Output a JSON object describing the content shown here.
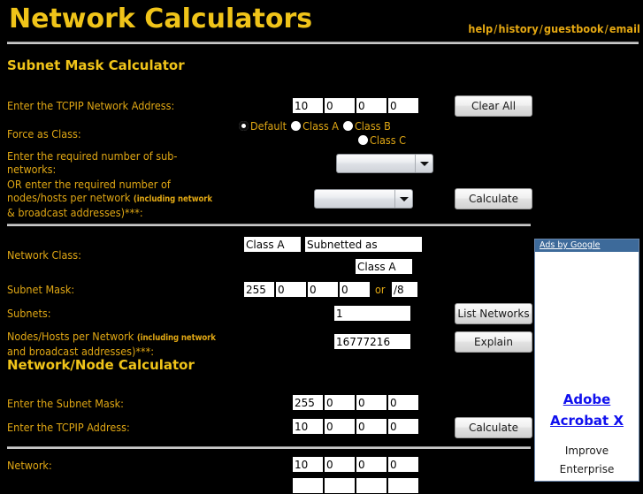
{
  "header": {
    "title": "Network Calculators",
    "nav": [
      {
        "label": "help"
      },
      {
        "label": "history"
      },
      {
        "label": "guestbook"
      },
      {
        "label": "email"
      }
    ],
    "separator": "/"
  },
  "subnet_calculator": {
    "title": "Subnet Mask Calculator",
    "network_address": {
      "label": "Enter the TCPIP Network Address:",
      "octets": [
        "10",
        "0",
        "0",
        "0"
      ],
      "clear_button": "Clear All"
    },
    "force_class": {
      "label": "Force as Class:",
      "options": [
        {
          "label": "Default",
          "selected": true
        },
        {
          "label": "Class A",
          "selected": false
        },
        {
          "label": "Class B",
          "selected": false
        },
        {
          "label": "Class C",
          "selected": false
        }
      ]
    },
    "subnets_input": {
      "label_line1": "Enter the required number of sub-",
      "label_line2": "networks:",
      "value": ""
    },
    "nodes_input": {
      "label_line1": "OR enter the required number of",
      "label_line2": "nodes/hosts per network ",
      "label_small1": "(including network",
      "label_small2": "& broadcast addresses)***:",
      "value": "",
      "calculate_button": "Calculate"
    },
    "results": {
      "network_class": {
        "label": "Network Class:",
        "class_value": "Class A",
        "subnetted_as_label": "Subnetted as",
        "subnetted_as_value": "Class A"
      },
      "subnet_mask": {
        "label": "Subnet Mask:",
        "octets": [
          "255",
          "0",
          "0",
          "0"
        ],
        "or_label": "or",
        "cidr": "/8"
      },
      "subnets": {
        "label": "Subnets:",
        "value": "1",
        "button": "List Networks"
      },
      "nodes": {
        "label": "Nodes/Hosts per Network ",
        "label_small1": "(including network",
        "label_small2": "and broadcast addresses)***:",
        "value": "16777216",
        "button": "Explain"
      }
    }
  },
  "node_calculator": {
    "title": "Network/Node Calculator",
    "subnet_mask": {
      "label": "Enter the Subnet Mask:",
      "octets": [
        "255",
        "0",
        "0",
        "0"
      ]
    },
    "tcpip_address": {
      "label": "Enter the TCPIP Address:",
      "octets": [
        "10",
        "0",
        "0",
        "0"
      ],
      "calculate_button": "Calculate"
    },
    "network_result": {
      "label": "Network:",
      "octets": [
        "10",
        "0",
        "0",
        "0"
      ]
    },
    "partial_row_octets": [
      "",
      "",
      "",
      ""
    ]
  },
  "ads": {
    "header": "Ads by Google",
    "title_line1": "Adobe",
    "title_line2": "Acrobat X",
    "desc_line1": "Improve",
    "desc_line2": "Enterprise"
  },
  "colors": {
    "background": "#000000",
    "text_gold": "#e0a714",
    "title_gold": "#f0c419",
    "divider": "#c9c9c9",
    "ads_header_bg": "#3d6a9a",
    "ad_link": "#1010ee"
  }
}
